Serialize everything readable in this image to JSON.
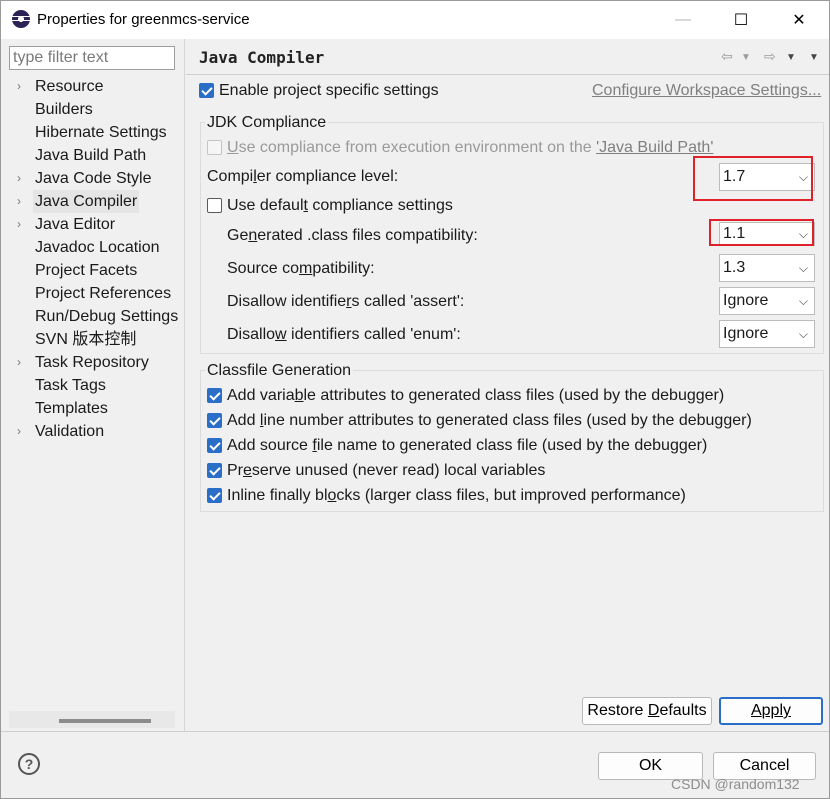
{
  "window": {
    "title": "Properties for greenmcs-service",
    "minimize": "—",
    "maximize": "☐",
    "close": "✕"
  },
  "filter": {
    "placeholder": "type filter text",
    "value": ""
  },
  "tree": [
    {
      "label": "Resource",
      "expandable": true
    },
    {
      "label": "Builders",
      "expandable": false
    },
    {
      "label": "Hibernate Settings",
      "expandable": false
    },
    {
      "label": "Java Build Path",
      "expandable": false
    },
    {
      "label": "Java Code Style",
      "expandable": true
    },
    {
      "label": "Java Compiler",
      "expandable": true,
      "selected": true
    },
    {
      "label": "Java Editor",
      "expandable": true
    },
    {
      "label": "Javadoc Location",
      "expandable": false
    },
    {
      "label": "Project Facets",
      "expandable": false
    },
    {
      "label": "Project References",
      "expandable": false
    },
    {
      "label": "Run/Debug Settings",
      "expandable": false
    },
    {
      "label": "SVN 版本控制",
      "expandable": false
    },
    {
      "label": "Task Repository",
      "expandable": true
    },
    {
      "label": "Task Tags",
      "expandable": false
    },
    {
      "label": "Templates",
      "expandable": false
    },
    {
      "label": "Validation",
      "expandable": true
    }
  ],
  "page": {
    "title": "Java Compiler",
    "nav_back": "⇦",
    "nav_forward": "⇨",
    "enable_specific": {
      "label_a": "Enable pro",
      "label_u": "j",
      "label_b": "ect specific settings",
      "checked": true
    },
    "configure_link": "Configure Workspace Settings..."
  },
  "jdk": {
    "group_title": "JDK Compliance",
    "use_env": {
      "label_u": "U",
      "label_a": "se compliance from execution environment on the ",
      "label_link": "'Java Build Path'",
      "checked": false,
      "disabled": true
    },
    "compliance_level": {
      "label_a": "Compi",
      "label_u": "l",
      "label_b": "er compliance level:",
      "value": "1.7"
    },
    "use_default": {
      "label_a": "Use defaul",
      "label_u": "t",
      "label_b": " compliance settings",
      "checked": false
    },
    "generated": {
      "label_a": "Ge",
      "label_u": "n",
      "label_b": "erated .class files compatibility:",
      "value": "1.1"
    },
    "source": {
      "label_a": "Source co",
      "label_u": "m",
      "label_b": "patibility:",
      "value": "1.3"
    },
    "assert": {
      "label_a": "Disallow identifie",
      "label_u": "r",
      "label_b": "s called 'assert':",
      "value": "Ignore"
    },
    "enum": {
      "label_a": "Disallo",
      "label_u": "w",
      "label_b": " identifiers called 'enum':",
      "value": "Ignore"
    }
  },
  "classfile": {
    "group_title": "Classfile Generation",
    "options": [
      {
        "a": "Add varia",
        "u": "b",
        "b": "le attributes to generated class files (used by the debugger)",
        "checked": true
      },
      {
        "a": "Add ",
        "u": "l",
        "b": "ine number attributes to generated class files (used by the debugger)",
        "checked": true
      },
      {
        "a": "Add source ",
        "u": "f",
        "b": "ile name to generated class file (used by the debugger)",
        "checked": true
      },
      {
        "a": "Pr",
        "u": "e",
        "b": "serve unused (never read) local variables",
        "checked": true
      },
      {
        "a": "Inline finally bl",
        "u": "o",
        "b": "cks (larger class files, but improved performance)",
        "checked": true
      }
    ]
  },
  "buttons": {
    "restore_a": "Restore ",
    "restore_u": "D",
    "restore_b": "efaults",
    "apply_u": "A",
    "apply_b": "pply",
    "ok": "OK",
    "cancel": "Cancel",
    "help": "?"
  },
  "watermark": "CSDN @random132",
  "colors": {
    "accent": "#2a6ec8",
    "highlight_box": "#e0202a"
  }
}
